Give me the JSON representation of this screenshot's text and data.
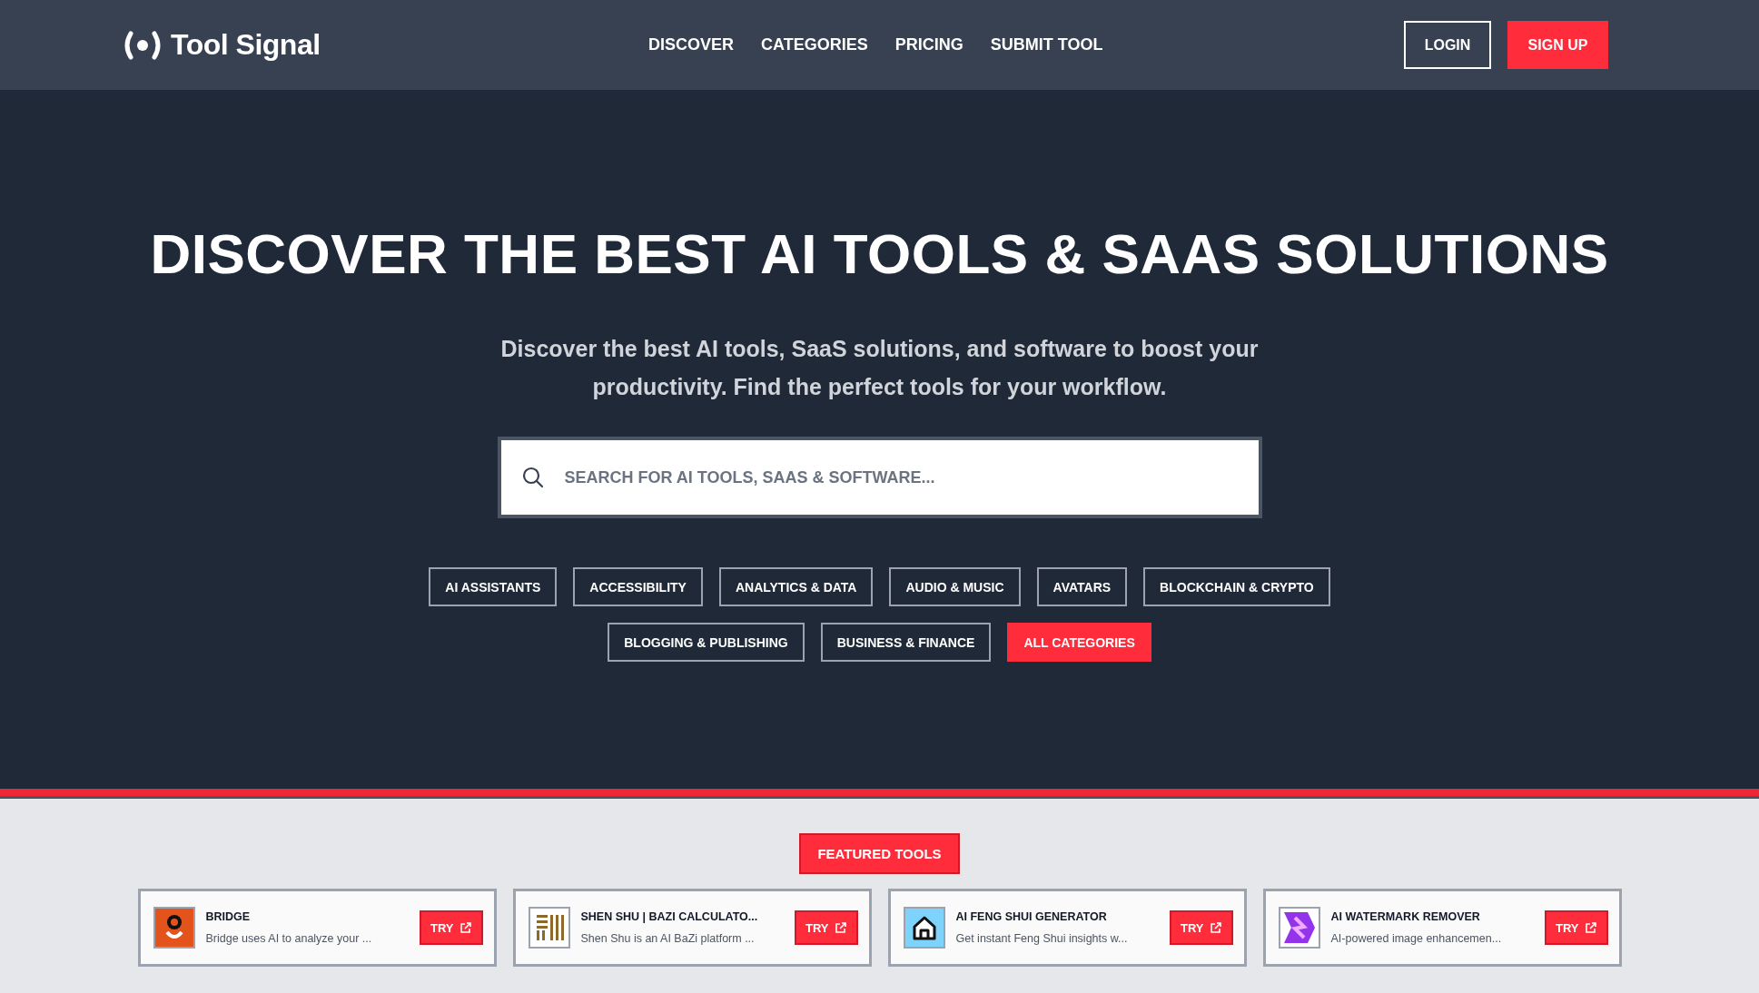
{
  "header": {
    "logo": "Tool Signal",
    "nav": [
      "DISCOVER",
      "CATEGORIES",
      "PRICING",
      "SUBMIT TOOL"
    ],
    "login": "LOGIN",
    "signup": "SIGN UP"
  },
  "hero": {
    "title": "DISCOVER THE BEST AI TOOLS & SAAS SOLUTIONS",
    "subtitle": "Discover the best AI tools, SaaS solutions, and software to boost your productivity. Find the perfect tools for your workflow.",
    "search": {
      "placeholder": "SEARCH FOR AI TOOLS, SAAS & SOFTWARE..."
    },
    "categories": [
      {
        "label": "AI ASSISTANTS",
        "selected": false
      },
      {
        "label": "ACCESSIBILITY",
        "selected": false
      },
      {
        "label": "ANALYTICS & DATA",
        "selected": false
      },
      {
        "label": "AUDIO & MUSIC",
        "selected": false
      },
      {
        "label": "AVATARS",
        "selected": false
      },
      {
        "label": "BLOCKCHAIN & CRYPTO",
        "selected": false
      },
      {
        "label": "BLOGGING & PUBLISHING",
        "selected": false
      },
      {
        "label": "BUSINESS & FINANCE",
        "selected": false
      },
      {
        "label": "ALL CATEGORIES",
        "selected": true
      }
    ]
  },
  "featured": {
    "badge": "FEATURED TOOLS",
    "tools": [
      {
        "name": "BRIDGE",
        "description": "Bridge uses AI to analyze your ...",
        "button": "TRY"
      },
      {
        "name": "SHEN SHU | BAZI CALCULATO...",
        "description": "Shen Shu is an AI BaZi platform ...",
        "button": "TRY"
      },
      {
        "name": "AI FENG SHUI GENERATOR",
        "description": "Get instant Feng Shui insights w...",
        "button": "TRY"
      },
      {
        "name": "AI WATERMARK REMOVER",
        "description": "AI-powered image enhancemen...",
        "button": "TRY"
      }
    ]
  }
}
